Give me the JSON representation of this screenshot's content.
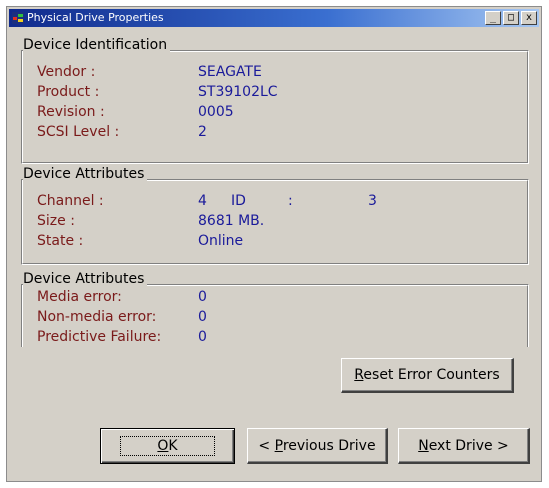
{
  "window": {
    "title": "Physical Drive Properties",
    "controls": {
      "minimize": "_",
      "maximize": "□",
      "close": "x"
    }
  },
  "identification": {
    "heading": "Device Identification",
    "rows": [
      {
        "label": "Vendor :",
        "value": "SEAGATE"
      },
      {
        "label": "Product :",
        "value": "ST39102LC"
      },
      {
        "label": "Revision :",
        "value": "0005"
      },
      {
        "label": "SCSI Level :",
        "value": "2"
      }
    ]
  },
  "attributes": {
    "heading": "Device Attributes",
    "channel_label": "Channel :",
    "channel_value": "4",
    "id_label": "ID",
    "id_colon": ":",
    "id_value": "3",
    "size_label": "Size :",
    "size_value": "8681 MB.",
    "state_label": "State :",
    "state_value": "Online"
  },
  "errors": {
    "heading": "Device Attributes",
    "rows": [
      {
        "label": "Media error:",
        "value": "0"
      },
      {
        "label": "Non-media error:",
        "value": "0"
      },
      {
        "label": "Predictive Failure:",
        "value": "0"
      }
    ]
  },
  "buttons": {
    "reset": {
      "first": "R",
      "rest": "eset Error Counters"
    },
    "ok": {
      "first": "O",
      "rest": "K"
    },
    "previous": {
      "prefix": "< ",
      "first": "P",
      "rest": "revious Drive"
    },
    "next": {
      "first": "N",
      "rest": "ext Drive >"
    }
  },
  "colors": {
    "label": "#7a1a1a",
    "value": "#1a1a9a",
    "face": "#d4d0c8",
    "title_start": "#102a8c"
  }
}
